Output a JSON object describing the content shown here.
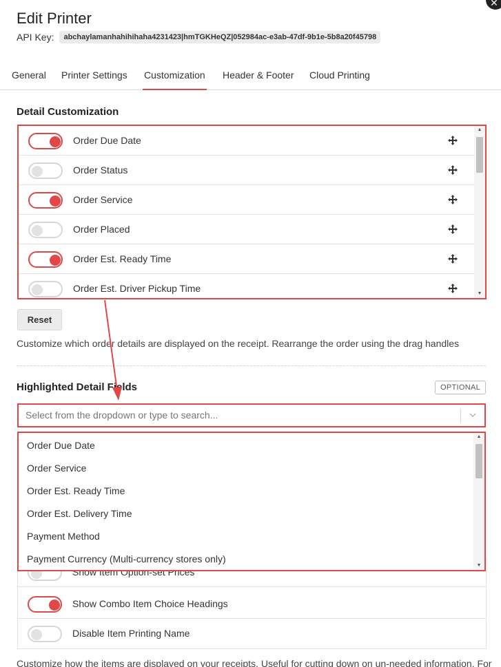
{
  "dialog": {
    "title": "Edit Printer",
    "api_key_label": "API Key:",
    "api_key_value": "abchaylamanhahihihaha4231423|hmTGKHeQZ|052984ac-e3ab-47df-9b1e-5b8a20f45798",
    "close_glyph": "✕"
  },
  "tabs": [
    {
      "label": "General",
      "active": false
    },
    {
      "label": "Printer Settings",
      "active": false
    },
    {
      "label": "Customization",
      "active": true
    },
    {
      "label": "Header & Footer",
      "active": false
    },
    {
      "label": "Cloud Printing",
      "active": false
    }
  ],
  "detail_customization": {
    "title": "Detail Customization",
    "items": [
      {
        "label": "Order Due Date",
        "enabled": true
      },
      {
        "label": "Order Status",
        "enabled": false
      },
      {
        "label": "Order Service",
        "enabled": true
      },
      {
        "label": "Order Placed",
        "enabled": false
      },
      {
        "label": "Order Est. Ready Time",
        "enabled": true
      },
      {
        "label": "Order Est. Driver Pickup Time",
        "enabled": false
      }
    ],
    "drag_icon": "move-icon",
    "reset_label": "Reset",
    "help_text": "Customize which order details are displayed on the receipt. Rearrange the order using the drag handles"
  },
  "highlighted_detail_fields": {
    "title": "Highlighted Detail Fields",
    "badge": "OPTIONAL",
    "placeholder": "Select from the dropdown or type to search...",
    "dropdown_options": [
      "Order Due Date",
      "Order Service",
      "Order Est. Ready Time",
      "Order Est. Delivery Time",
      "Payment Method",
      "Payment Currency (Multi-currency stores only)"
    ]
  },
  "item_customization": {
    "items": [
      {
        "label": "Show Item Option-set Prices",
        "enabled": false
      },
      {
        "label": "Show Combo Item Choice Headings",
        "enabled": true
      },
      {
        "label": "Disable Item Printing Name",
        "enabled": false
      }
    ],
    "help_text": "Customize how the items are displayed on your receipts. Useful for cutting down on un-needed information. For"
  },
  "colors": {
    "accent": "#e04848",
    "toggle_off_border": "#d6d6d6",
    "annotation": "#e04848"
  }
}
